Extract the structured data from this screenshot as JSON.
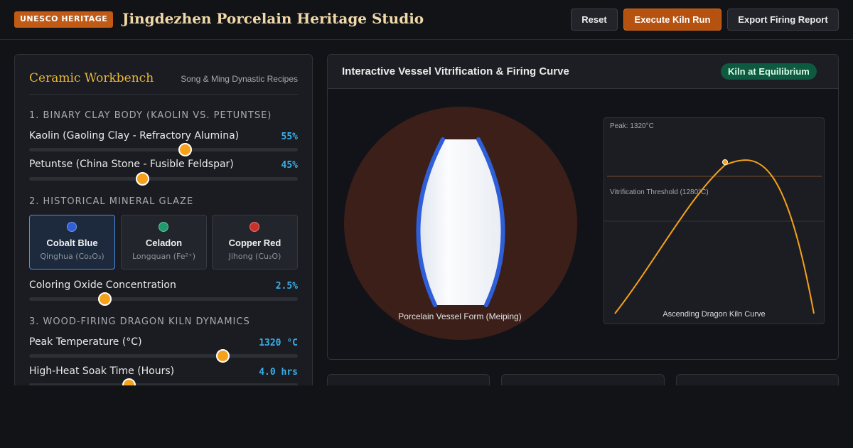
{
  "header": {
    "badge": "UNESCO HERITAGE",
    "title": "Jingdezhen Porcelain Heritage Studio",
    "buttons": {
      "reset": "Reset",
      "run": "Execute Kiln Run",
      "export": "Export Firing Report"
    }
  },
  "workbench": {
    "title": "Ceramic Workbench",
    "subtitle": "Song & Ming Dynastic Recipes",
    "sections": {
      "clay": "1. BINARY CLAY BODY (KAOLIN VS. PETUNTSE)",
      "glaze": "2. HISTORICAL MINERAL GLAZE",
      "kiln": "3. WOOD-FIRING DRAGON KILN DYNAMICS"
    },
    "params": {
      "kaolin": {
        "label": "Kaolin (Gaoling Clay - Refractory Alumina)",
        "value": "55%",
        "level": 0.58
      },
      "petuntse": {
        "label": "Petuntse (China Stone - Fusible Feldspar)",
        "value": "45%",
        "level": 0.42
      },
      "oxide": {
        "label": "Coloring Oxide Concentration",
        "value": "2.5%",
        "level": 0.28
      },
      "peak_temp": {
        "label": "Peak Temperature (°C)",
        "value": "1320 °C",
        "level": 0.72
      },
      "soak": {
        "label": "High-Heat Soak Time (Hours)",
        "value": "4.0 hrs",
        "level": 0.37
      }
    },
    "glazes": [
      {
        "name": "Cobalt Blue",
        "chem": "Qinghua (Co₂O₃)",
        "color": "#2f5fd8",
        "active": true
      },
      {
        "name": "Celadon",
        "chem": "Longquan (Fe²⁺)",
        "color": "#1f9a6c",
        "active": false
      },
      {
        "name": "Copper Red",
        "chem": "Jihong (Cu₂O)",
        "color": "#c9322b",
        "active": false
      }
    ]
  },
  "vessel_panel": {
    "title": "Interactive Vessel Vitrification & Firing Curve",
    "status": "Kiln at Equilibrium",
    "vessel_caption": "Porcelain Vessel Form (Meiping)",
    "curve": {
      "peak_label": "Peak: 1320°C",
      "threshold_label": "Vitrification Threshold (1280°C)",
      "caption": "Ascending Dragon Kiln Curve"
    }
  },
  "colors": {
    "accent_orange": "#f5a11a",
    "primary_button": "#b55210",
    "value_blue": "#3aaee8",
    "title_gold": "#e8b73a",
    "status_green": "#0e5a40",
    "kiln_glow": "#3c1f19",
    "vessel_glaze": "#2f5fd8"
  }
}
